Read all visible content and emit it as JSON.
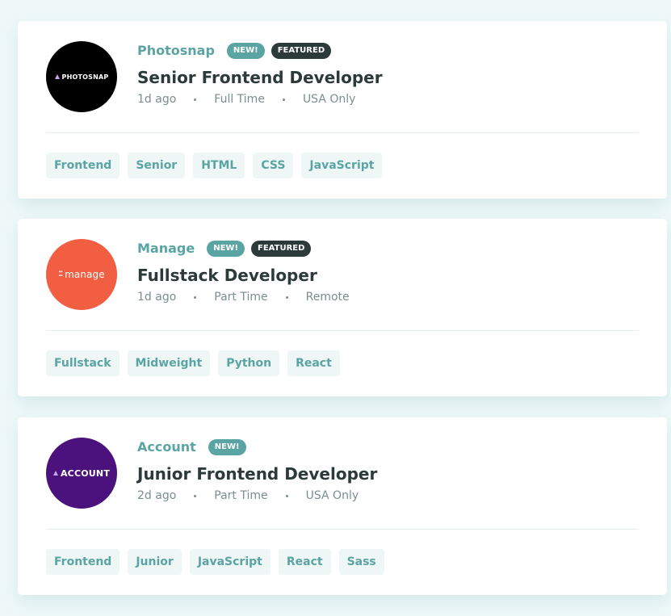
{
  "jobs": [
    {
      "logo_text": "PHOTOSNAP",
      "logo_color": "#000000",
      "company": "Photosnap",
      "new_label": "NEW!",
      "featured_label": "FEATURED",
      "position": "Senior Frontend Developer",
      "posted": "1d ago",
      "contract": "Full Time",
      "location": "USA Only",
      "tags": [
        "Frontend",
        "Senior",
        "HTML",
        "CSS",
        "JavaScript"
      ]
    },
    {
      "logo_text": "manage",
      "logo_color": "#f15e41",
      "company": "Manage",
      "new_label": "NEW!",
      "featured_label": "FEATURED",
      "position": "Fullstack Developer",
      "posted": "1d ago",
      "contract": "Part Time",
      "location": "Remote",
      "tags": [
        "Fullstack",
        "Midweight",
        "Python",
        "React"
      ]
    },
    {
      "logo_text": "ACCOUNT",
      "logo_color": "#4b127d",
      "company": "Account",
      "new_label": "NEW!",
      "position": "Junior Frontend Developer",
      "posted": "2d ago",
      "contract": "Part Time",
      "location": "USA Only",
      "tags": [
        "Frontend",
        "Junior",
        "JavaScript",
        "React",
        "Sass"
      ]
    }
  ],
  "colors": {
    "page_background": "#eef8f9",
    "accent": "#5ba4a4",
    "dark": "#2c3a3a",
    "muted": "#7b8e8e",
    "tag_background": "#eef6f6"
  }
}
